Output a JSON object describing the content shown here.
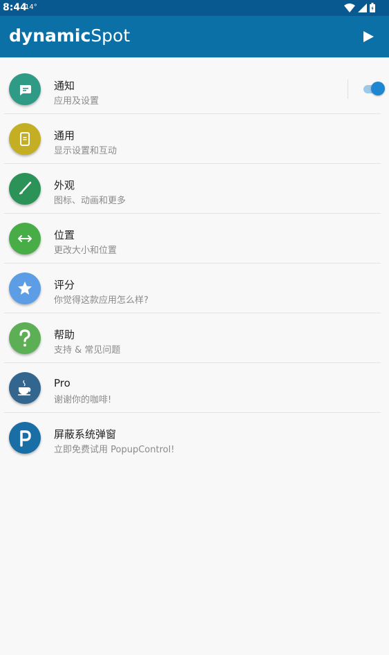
{
  "status_bar": {
    "time": "8:44",
    "temperature": "14°",
    "icons": [
      "wifi-icon",
      "cell-signal-icon",
      "battery-icon"
    ]
  },
  "app_bar": {
    "title_bold": "dynamic",
    "title_light": "Spot",
    "background_color": "#0a70a6",
    "action_icon": "play-icon"
  },
  "items": [
    {
      "title": "通知",
      "subtitle": "应用及设置",
      "color": "#2f9a86",
      "icon": "chat-icon",
      "toggle": true
    },
    {
      "title": "通用",
      "subtitle": "显示设置和互动",
      "color": "#c3ae24",
      "icon": "phone-icon"
    },
    {
      "title": "外观",
      "subtitle": "图标、动画和更多",
      "color": "#2c9358",
      "icon": "brush-icon"
    },
    {
      "title": "位置",
      "subtitle": "更改大小和位置",
      "color": "#48ad47",
      "icon": "arrows-horizontal-icon"
    },
    {
      "title": "评分",
      "subtitle": "你觉得这款应用怎么样?",
      "color": "#5c9de5",
      "icon": "star-icon"
    },
    {
      "title": "帮助",
      "subtitle": "支持 & 常见问题",
      "color": "#5daf56",
      "icon": "question-icon"
    },
    {
      "title": "Pro",
      "subtitle": "谢谢你的咖啡!",
      "color": "#33668f",
      "icon": "coffee-cup-icon"
    },
    {
      "title": "屏蔽系统弹窗",
      "subtitle": "立即免费试用 PopupControl!",
      "color": "#1a6ea6",
      "icon": "popupcontrol-logo-icon"
    }
  ],
  "toggle_state": "on",
  "toggle_color": "#1d86d0"
}
